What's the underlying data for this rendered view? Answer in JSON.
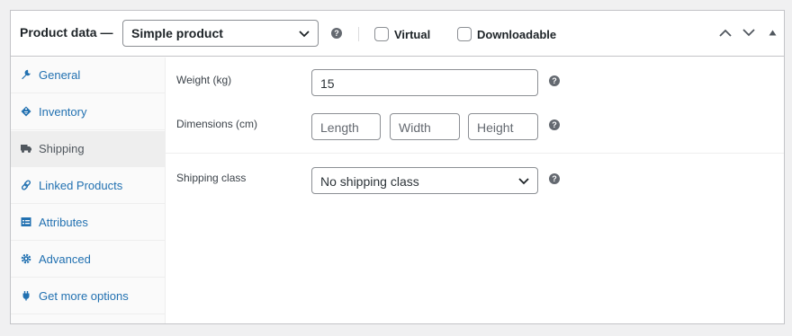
{
  "header": {
    "title": "Product data —",
    "product_type": "Simple product",
    "virtual_label": "Virtual",
    "downloadable_label": "Downloadable",
    "help_glyph": "?"
  },
  "tabs": [
    {
      "label": "General",
      "icon": "wrench-icon",
      "active": false
    },
    {
      "label": "Inventory",
      "icon": "tag-icon",
      "active": false
    },
    {
      "label": "Shipping",
      "icon": "truck-icon",
      "active": true
    },
    {
      "label": "Linked Products",
      "icon": "link-icon",
      "active": false
    },
    {
      "label": "Attributes",
      "icon": "list-icon",
      "active": false
    },
    {
      "label": "Advanced",
      "icon": "gear-icon",
      "active": false
    },
    {
      "label": "Get more options",
      "icon": "plugin-icon",
      "active": false
    }
  ],
  "shipping": {
    "weight_label": "Weight (kg)",
    "weight_value": "15",
    "dimensions_label": "Dimensions (cm)",
    "length_placeholder": "Length",
    "width_placeholder": "Width",
    "height_placeholder": "Height",
    "class_label": "Shipping class",
    "class_value": "No shipping class"
  },
  "colors": {
    "link": "#2271b1",
    "active_tab_bg": "#eeeeee",
    "border": "#c3c4c7"
  }
}
